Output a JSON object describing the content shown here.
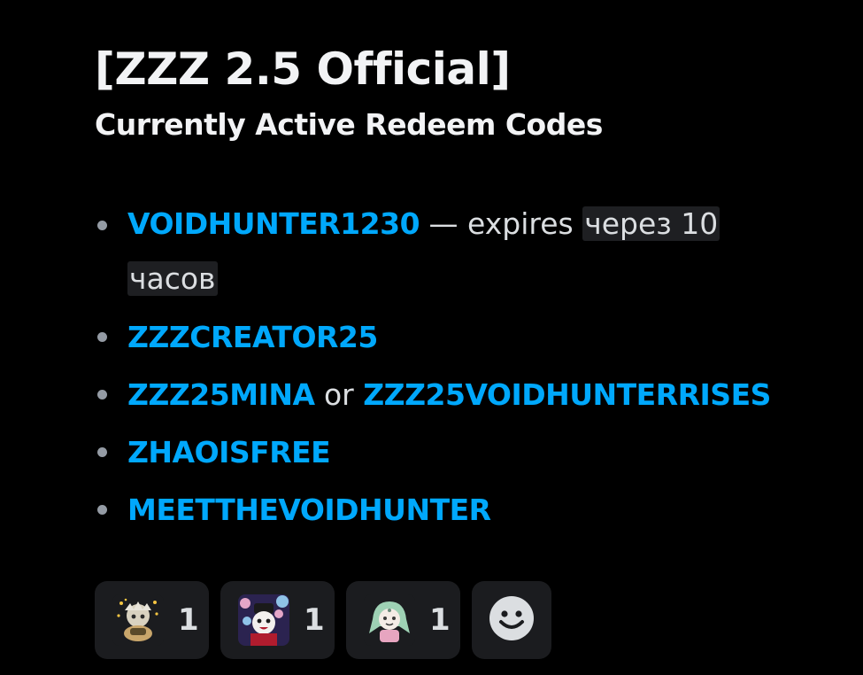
{
  "message": {
    "title": "[ZZZ 2.5 Official]",
    "subtitle": "Currently Active Redeem Codes",
    "codes": [
      {
        "code": "VOIDHUNTER1230",
        "separator": " — ",
        "expires_label": "expires ",
        "timestamp": "через 10 часов"
      },
      {
        "code": "ZZZCREATOR25"
      },
      {
        "code": "ZZZ25MINA",
        "or_label": " or ",
        "alt_code": "ZZZ25VOIDHUNTERRISES"
      },
      {
        "code": "ZHAOISFREE"
      },
      {
        "code": "MEETTHEVOIDHUNTER"
      }
    ]
  },
  "reactions": [
    {
      "emoji": "custom-emoji-character-sparkles",
      "count": "1"
    },
    {
      "emoji": "custom-emoji-character-sakura",
      "count": "1"
    },
    {
      "emoji": "custom-emoji-character-green-hair",
      "count": "1"
    }
  ],
  "add_reaction_icon": "add-reaction-smiley-icon",
  "colors": {
    "background": "#000000",
    "code_link": "#00a8fc",
    "text": "#dbdee1",
    "heading": "#f2f3f5",
    "reaction_bg": "#1b1c1f"
  }
}
